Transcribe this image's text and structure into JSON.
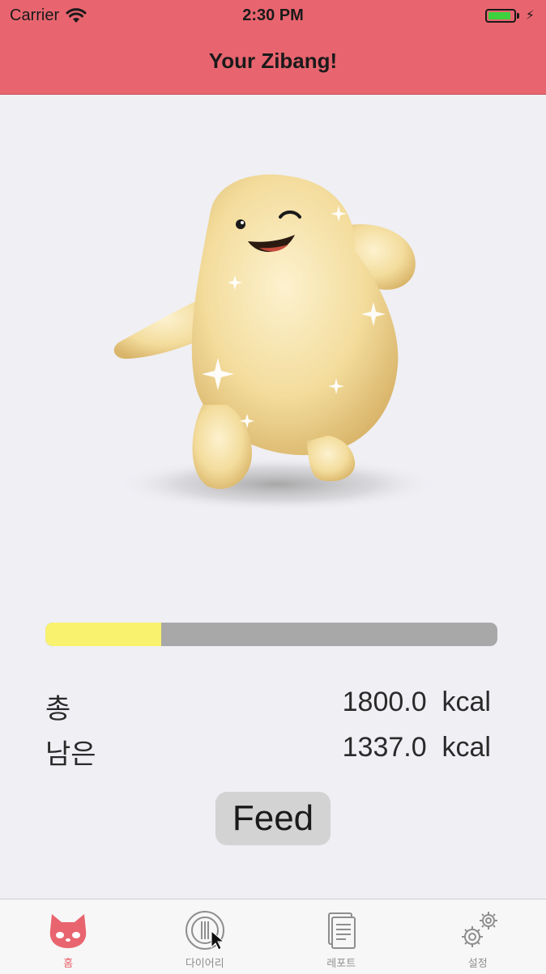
{
  "status_bar": {
    "carrier": "Carrier",
    "time": "2:30 PM",
    "battery_level": 0.9
  },
  "nav": {
    "title": "Your Zibang!"
  },
  "progress": {
    "value": 0.257
  },
  "stats": {
    "total_label": "총",
    "total_value": "1800.0  kcal",
    "remaining_label": "남은",
    "remaining_value": "1337.0  kcal"
  },
  "feed_button": {
    "label": "Feed"
  },
  "tabs": [
    {
      "label": "홈",
      "icon": "cat-face-icon",
      "active": true
    },
    {
      "label": "다이어리",
      "icon": "plate-cutlery-icon",
      "active": false
    },
    {
      "label": "레포트",
      "icon": "report-document-icon",
      "active": false
    },
    {
      "label": "설정",
      "icon": "gears-icon",
      "active": false
    }
  ],
  "colors": {
    "accent": "#e8656f",
    "progress_fill": "#f9f26e",
    "progress_track": "#a8a8a8",
    "background": "#efeff4"
  }
}
